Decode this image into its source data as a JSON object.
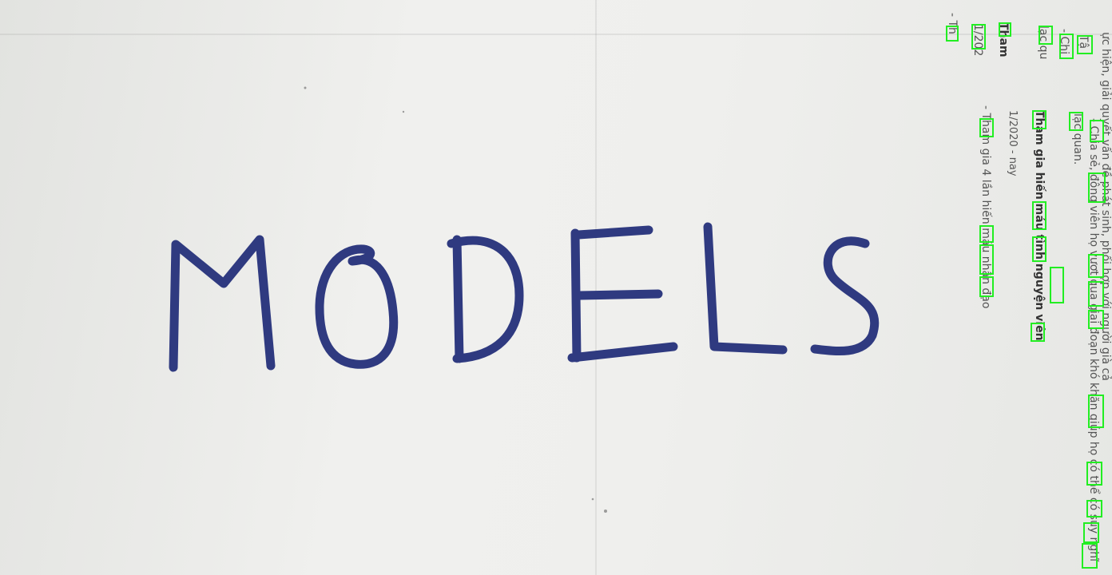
{
  "photo": {
    "handwritten_word": "MODELS",
    "ink_color": "#2f3a80",
    "paper_color": "#eeeeec",
    "box_color": "#22ee22"
  },
  "text_lines": [
    {
      "text": "ực hiện, giải quyết vấn đề phát sinh, phối hợp với người già cả",
      "bold": false
    },
    {
      "text": "- Chia sẻ, động viên họ vượt qua giai đoạn khó khăn giúp họ có thể có suy nghĩ",
      "bold": false
    },
    {
      "text": "lạc quan.",
      "bold": false
    },
    {
      "text": "Tham gia hiến máu tình nguyện viên",
      "bold": true
    },
    {
      "text": "1/2020 - nay",
      "bold": false
    },
    {
      "text": "- Tham gia 4 lần hiến máu nhân đạo",
      "bold": false
    }
  ],
  "partial_text": [
    {
      "text": "Tậ"
    },
    {
      "text": "- Chi"
    },
    {
      "text": "lạc qu"
    },
    {
      "text": "Tham"
    },
    {
      "text": "1/202"
    },
    {
      "text": "- Th"
    }
  ]
}
